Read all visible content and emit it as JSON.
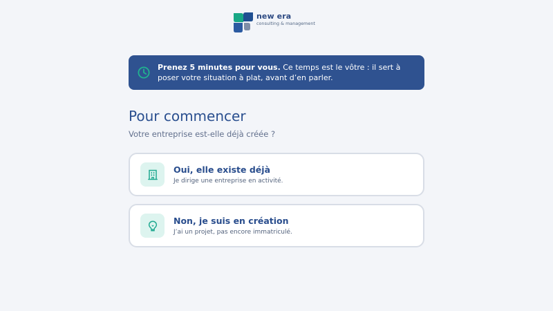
{
  "brand": {
    "name": "new era",
    "tagline": "consulting & management"
  },
  "banner": {
    "emphasis": "Prenez 5 minutes pour vous.",
    "message": "Ce temps est le vôtre : il sert à poser votre situation à plat, avant d’en parler.",
    "icon": "clock-icon"
  },
  "intro": {
    "title": "Pour commencer",
    "question": "Votre entreprise est-elle déjà créée ?"
  },
  "options": [
    {
      "title": "Oui, elle existe déjà",
      "subtitle": "Je dirige une entreprise en activité.",
      "icon": "building-icon"
    },
    {
      "title": "Non, je suis en création",
      "subtitle": "J’ai un projet, pas encore immatriculé.",
      "icon": "lightbulb-icon"
    }
  ],
  "colors": {
    "page_background": "#f3f5f9",
    "banner_background": "#2f5290",
    "accent_teal": "#20a990",
    "title_blue": "#2a4f8f"
  }
}
